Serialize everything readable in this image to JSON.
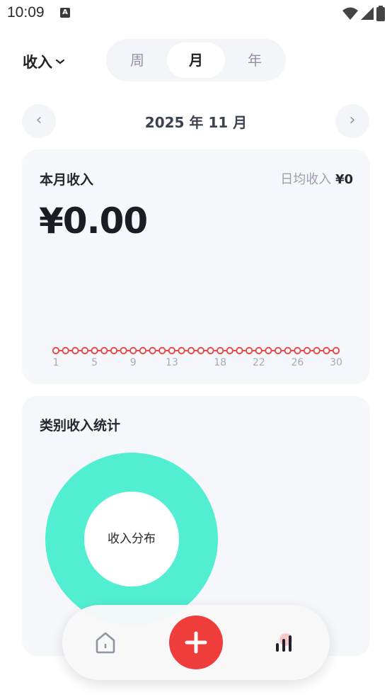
{
  "status": {
    "time": "10:09",
    "a_badge": "A"
  },
  "header": {
    "type_selector": "收入",
    "periods": [
      "周",
      "月",
      "年"
    ],
    "active_period": "月"
  },
  "month_nav": {
    "label": "2025 年 11 月",
    "prev": "‹",
    "next": "›"
  },
  "summary_card": {
    "title": "本月收入",
    "daily_avg_label": "日均收入",
    "daily_avg_value": "¥0",
    "total": "¥0.00"
  },
  "chart_data": {
    "type": "line",
    "x": [
      1,
      2,
      3,
      4,
      5,
      6,
      7,
      8,
      9,
      10,
      11,
      12,
      13,
      14,
      15,
      16,
      17,
      18,
      19,
      20,
      21,
      22,
      23,
      24,
      25,
      26,
      27,
      28,
      29,
      30
    ],
    "series": [
      {
        "values": [
          0,
          0,
          0,
          0,
          0,
          0,
          0,
          0,
          0,
          0,
          0,
          0,
          0,
          0,
          0,
          0,
          0,
          0,
          0,
          0,
          0,
          0,
          0,
          0,
          0,
          0,
          0,
          0,
          0,
          0
        ]
      }
    ],
    "tick_labels": [
      "1",
      "5",
      "9",
      "13",
      "18",
      "22",
      "26",
      "30"
    ],
    "color": "#e84b4b"
  },
  "category_card": {
    "title": "类别收入统计",
    "donut_center": "收入分布",
    "donut_color": "#52eed2"
  },
  "bottom_nav": {
    "home_icon": "home-icon",
    "add_icon": "plus-icon",
    "stats_icon": "bar-chart-icon"
  }
}
